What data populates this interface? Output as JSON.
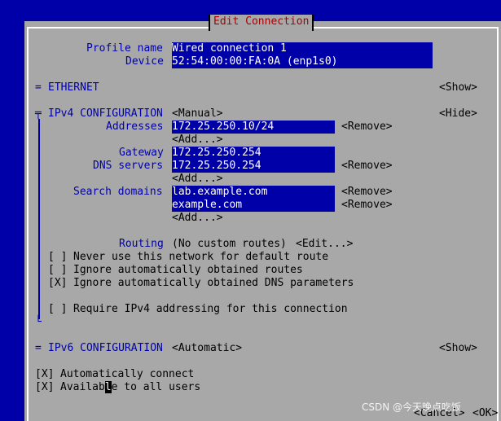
{
  "title": "Edit Connection",
  "profile": {
    "profile_name_label": "Profile name",
    "profile_name_value": "Wired connection 1",
    "device_label": "Device",
    "device_value": "52:54:00:00:FA:0A (enp1s0)"
  },
  "ethernet": {
    "marker": "=",
    "label": "ETHERNET",
    "toggle": "<Show>"
  },
  "ipv4": {
    "marker": "╤",
    "label": "IPv4 CONFIGURATION",
    "mode": "<Manual>",
    "toggle": "<Hide>",
    "addresses_label": "Addresses",
    "addresses": [
      "172.25.250.10/24"
    ],
    "gateway_label": "Gateway",
    "gateway": "172.25.250.254",
    "dns_label": "DNS servers",
    "dns": [
      "172.25.250.254"
    ],
    "search_label": "Search domains",
    "search": [
      "lab.example.com",
      "example.com"
    ],
    "add_label": "<Add...>",
    "remove_label": "<Remove>",
    "routing_label": "Routing",
    "routing_value": "(No custom routes)",
    "routing_edit": "<Edit...>",
    "never_default": {
      "box": "[ ]",
      "label": "Never use this network for default route"
    },
    "ignore_routes": {
      "box": "[ ]",
      "label": "Ignore automatically obtained routes"
    },
    "ignore_dns": {
      "box": "[X]",
      "label": "Ignore automatically obtained DNS parameters"
    },
    "require_ipv4": {
      "box": "[ ]",
      "label": "Require IPv4 addressing for this connection"
    },
    "bottom_marker": "└"
  },
  "ipv6": {
    "marker": "=",
    "label": "IPv6 CONFIGURATION",
    "mode": "<Automatic>",
    "toggle": "<Show>"
  },
  "auto_connect": {
    "box": "[X]",
    "label": "Automatically connect"
  },
  "available_all": {
    "box": "[X]",
    "label_before": "Availab",
    "cursor_char": "l",
    "label_after": "e to all users"
  },
  "buttons": {
    "cancel": "<Cancel>",
    "ok": "<OK>"
  },
  "watermark": "CSDN @今天晚点吃饭"
}
